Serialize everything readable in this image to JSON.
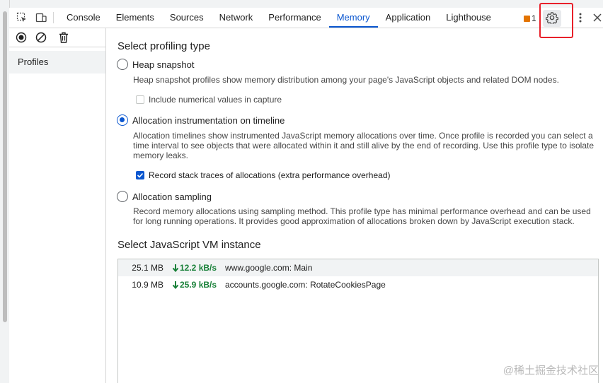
{
  "toolbar": {
    "tabs": [
      {
        "label": "Console",
        "active": false
      },
      {
        "label": "Elements",
        "active": false
      },
      {
        "label": "Sources",
        "active": false
      },
      {
        "label": "Network",
        "active": false
      },
      {
        "label": "Performance",
        "active": false
      },
      {
        "label": "Memory",
        "active": true
      },
      {
        "label": "Application",
        "active": false
      },
      {
        "label": "Lighthouse",
        "active": false
      }
    ],
    "warning_count": "1",
    "icons": [
      "inspect-element-icon",
      "device-toolbar-icon",
      "warning-icon",
      "settings-gear-icon",
      "more-options-icon",
      "close-icon"
    ],
    "accent_color": "#0b57d0",
    "highlight_color": "#e8202a"
  },
  "sidebar": {
    "icons": [
      "record-icon",
      "clear-icon",
      "trash-icon"
    ],
    "items": [
      {
        "label": "Profiles"
      }
    ]
  },
  "main": {
    "profiling_title": "Select profiling type",
    "options": [
      {
        "label": "Heap snapshot",
        "selected": false,
        "description": "Heap snapshot profiles show memory distribution among your page's JavaScript objects and related DOM nodes.",
        "checkbox": {
          "label": "Include numerical values in capture",
          "checked": false
        }
      },
      {
        "label": "Allocation instrumentation on timeline",
        "selected": true,
        "description": "Allocation timelines show instrumented JavaScript memory allocations over time. Once profile is recorded you can select a time interval to see objects that were allocated within it and still alive by the end of recording. Use this profile type to isolate memory leaks.",
        "checkbox": {
          "label": "Record stack traces of allocations (extra performance overhead)",
          "checked": true
        }
      },
      {
        "label": "Allocation sampling",
        "selected": false,
        "description": "Record memory allocations using sampling method. This profile type has minimal performance overhead and can be used for long running operations. It provides good approximation of allocations broken down by JavaScript execution stack."
      }
    ],
    "vm_title": "Select JavaScript VM instance",
    "vm_instances": [
      {
        "size": "25.1 MB",
        "rate": "12.2 kB/s",
        "name": "www.google.com: Main",
        "selected": true
      },
      {
        "size": "10.9 MB",
        "rate": "25.9 kB/s",
        "name": "accounts.google.com: RotateCookiesPage",
        "selected": false
      }
    ]
  },
  "watermark": "@稀土掘金技术社区"
}
